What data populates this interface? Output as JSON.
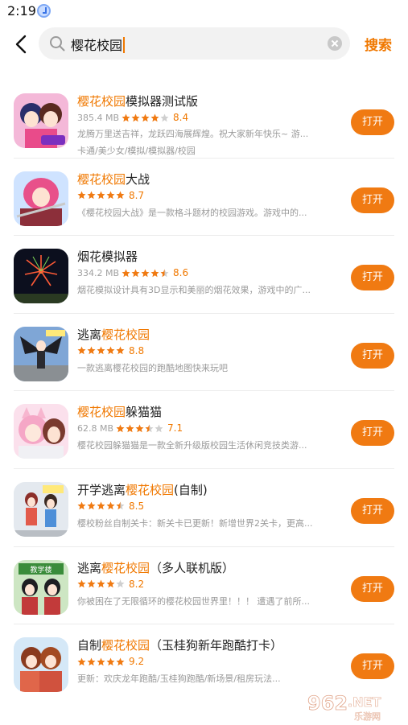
{
  "status_bar": {
    "time": "2:19"
  },
  "search": {
    "query": "樱花校园",
    "search_label": "搜索"
  },
  "colors": {
    "accent": "#f07800",
    "star": "#f07a12",
    "star_empty": "#cfcfcf"
  },
  "results": [
    {
      "name_prefix": "",
      "name_highlight": "樱花校园",
      "name_suffix": "模拟器测试版",
      "size": "385.4 MB",
      "stars": 4,
      "rating": "8.4",
      "desc": "龙腾万里送吉祥，龙跃四海展辉煌。祝大家新年快乐~ 游...",
      "tags": "卡通/美少女/模拟/模拟器/校园",
      "button": "打开",
      "icon": "anime-girls-icon"
    },
    {
      "name_prefix": "",
      "name_highlight": "樱花校园",
      "name_suffix": "大战",
      "size": "",
      "stars": 5,
      "rating": "8.7",
      "desc": "《樱花校园大战》是一款格斗题材的校园游戏。游戏中的...",
      "tags": "",
      "button": "打开",
      "icon": "pink-hair-fighter-icon"
    },
    {
      "name_prefix": "烟花模拟器",
      "name_highlight": "",
      "name_suffix": "",
      "size": "334.2 MB",
      "stars": 4.5,
      "rating": "8.6",
      "desc": "烟花模拟设计具有3D显示和美丽的烟花效果，游戏中的广...",
      "tags": "",
      "button": "打开",
      "icon": "fireworks-icon"
    },
    {
      "name_prefix": "逃离",
      "name_highlight": "樱花校园",
      "name_suffix": "",
      "size": "",
      "stars": 5,
      "rating": "8.8",
      "desc": "一款逃离樱花校园的跑酷地图快来玩吧",
      "tags": "",
      "button": "打开",
      "icon": "winged-figure-icon"
    },
    {
      "name_prefix": "",
      "name_highlight": "樱花校园",
      "name_suffix": "躲猫猫",
      "size": "62.8 MB",
      "stars": 3.5,
      "rating": "7.1",
      "desc": "樱花校园躲猫猫是一款全新升级版校园生活休闲竞技类游...",
      "tags": "",
      "button": "打开",
      "icon": "cat-ear-girls-icon"
    },
    {
      "name_prefix": "开学逃离",
      "name_highlight": "樱花校园",
      "name_suffix": "(自制)",
      "size": "",
      "stars": 4.5,
      "rating": "8.5",
      "desc": "樱校粉丝自制关卡：新关卡已更新！新增世界2关卡，更高...",
      "tags": "",
      "button": "打开",
      "icon": "students-icon"
    },
    {
      "name_prefix": "逃离",
      "name_highlight": "樱花校园",
      "name_suffix": "（多人联机版）",
      "size": "",
      "stars": 4,
      "rating": "8.2",
      "desc": "你被困在了无限循环的樱花校园世界里！！！ 遭遇了前所...",
      "tags": "",
      "button": "打开",
      "icon": "school-building-icon"
    },
    {
      "name_prefix": "自制",
      "name_highlight": "樱花校园",
      "name_suffix": "（玉桂狗新年跑酷打卡）",
      "size": "",
      "stars": 5,
      "rating": "9.2",
      "desc": "更新：欢庆龙年跑酷/玉桂狗跑酷/新场景/租房玩法...",
      "tags": "",
      "button": "打开",
      "icon": "couple-icon"
    }
  ],
  "watermark": {
    "number": "962",
    "suffix": ".NET",
    "site": "乐游网"
  }
}
